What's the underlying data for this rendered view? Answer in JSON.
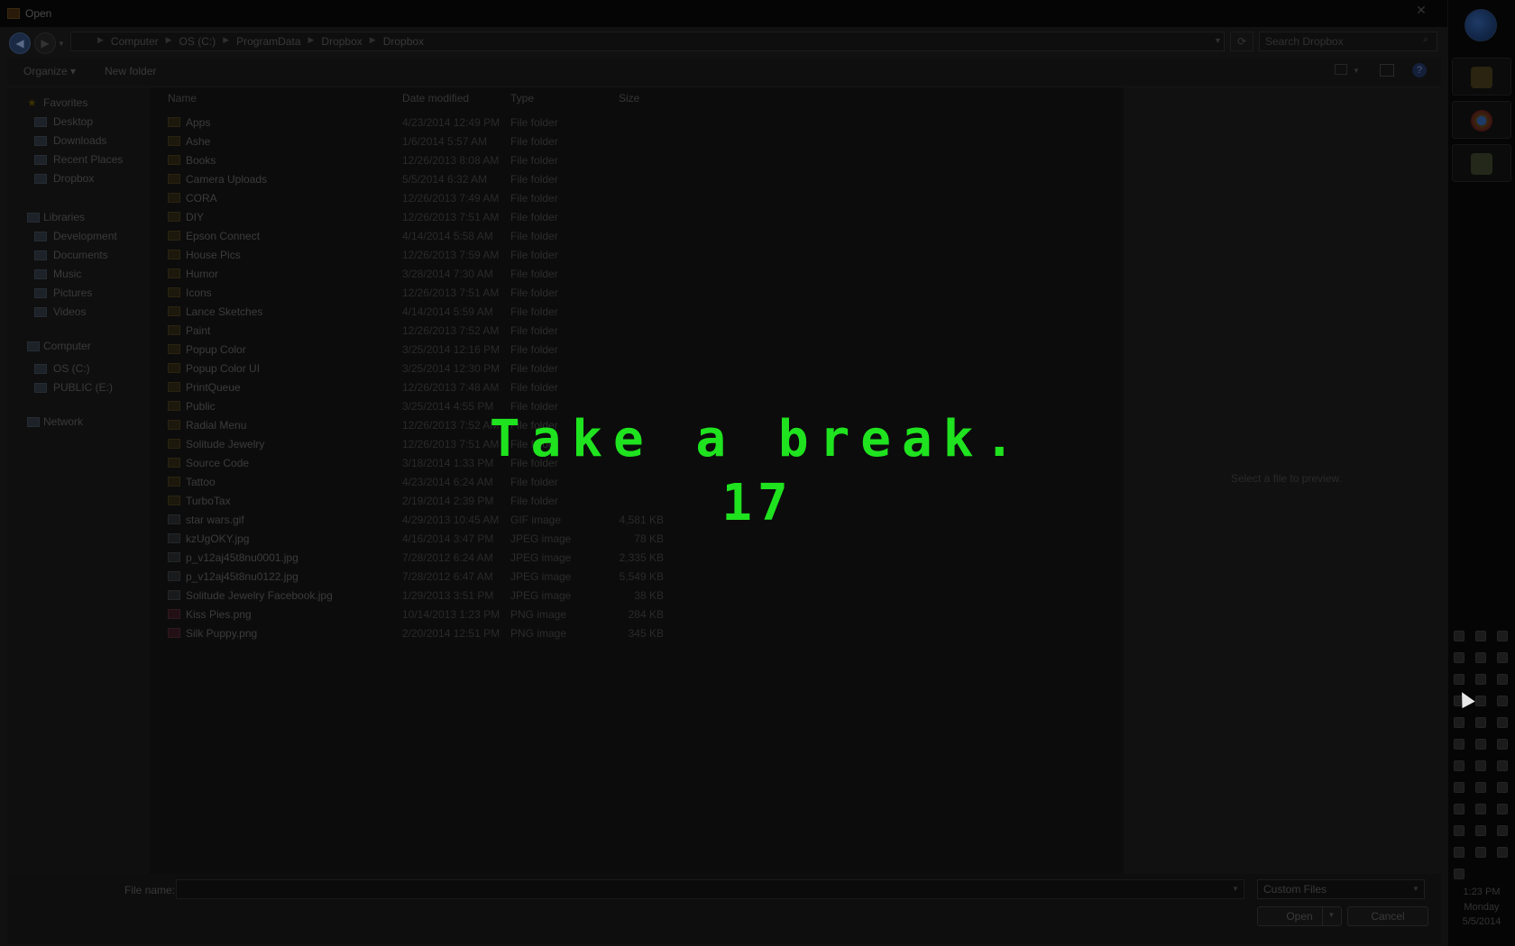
{
  "window": {
    "title": "Open"
  },
  "address": {
    "crumbs": [
      "Computer",
      "OS (C:)",
      "ProgramData",
      "Dropbox",
      "Dropbox"
    ],
    "search_placeholder": "Search Dropbox"
  },
  "toolbar": {
    "organize": "Organize ▾",
    "new_folder": "New folder"
  },
  "nav": {
    "favorites": "Favorites",
    "favorite_items": [
      "Desktop",
      "Downloads",
      "Recent Places",
      "Dropbox"
    ],
    "libraries": "Libraries",
    "library_items": [
      "Development",
      "Documents",
      "Music",
      "Pictures",
      "Videos"
    ],
    "computer": "Computer",
    "computer_items": [
      "OS (C:)",
      "PUBLIC (E:)"
    ],
    "network": "Network"
  },
  "columns": {
    "name": "Name",
    "date": "Date modified",
    "type": "Type",
    "size": "Size"
  },
  "files": [
    {
      "name": "Apps",
      "date": "4/23/2014 12:49 PM",
      "type": "File folder",
      "size": "",
      "kind": "folder"
    },
    {
      "name": "Ashe",
      "date": "1/6/2014 5:57 AM",
      "type": "File folder",
      "size": "",
      "kind": "folder"
    },
    {
      "name": "Books",
      "date": "12/26/2013 8:08 AM",
      "type": "File folder",
      "size": "",
      "kind": "folder"
    },
    {
      "name": "Camera Uploads",
      "date": "5/5/2014 6:32 AM",
      "type": "File folder",
      "size": "",
      "kind": "folder"
    },
    {
      "name": "CORA",
      "date": "12/26/2013 7:49 AM",
      "type": "File folder",
      "size": "",
      "kind": "folder"
    },
    {
      "name": "DIY",
      "date": "12/26/2013 7:51 AM",
      "type": "File folder",
      "size": "",
      "kind": "folder"
    },
    {
      "name": "Epson Connect",
      "date": "4/14/2014 5:58 AM",
      "type": "File folder",
      "size": "",
      "kind": "folder"
    },
    {
      "name": "House Pics",
      "date": "12/26/2013 7:59 AM",
      "type": "File folder",
      "size": "",
      "kind": "folder"
    },
    {
      "name": "Humor",
      "date": "3/28/2014 7:30 AM",
      "type": "File folder",
      "size": "",
      "kind": "folder"
    },
    {
      "name": "Icons",
      "date": "12/26/2013 7:51 AM",
      "type": "File folder",
      "size": "",
      "kind": "folder"
    },
    {
      "name": "Lance Sketches",
      "date": "4/14/2014 5:59 AM",
      "type": "File folder",
      "size": "",
      "kind": "folder"
    },
    {
      "name": "Paint",
      "date": "12/26/2013 7:52 AM",
      "type": "File folder",
      "size": "",
      "kind": "folder"
    },
    {
      "name": "Popup Color",
      "date": "3/25/2014 12:16 PM",
      "type": "File folder",
      "size": "",
      "kind": "folder"
    },
    {
      "name": "Popup Color UI",
      "date": "3/25/2014 12:30 PM",
      "type": "File folder",
      "size": "",
      "kind": "folder"
    },
    {
      "name": "PrintQueue",
      "date": "12/26/2013 7:48 AM",
      "type": "File folder",
      "size": "",
      "kind": "folder"
    },
    {
      "name": "Public",
      "date": "3/25/2014 4:55 PM",
      "type": "File folder",
      "size": "",
      "kind": "folder"
    },
    {
      "name": "Radial Menu",
      "date": "12/26/2013 7:52 AM",
      "type": "File folder",
      "size": "",
      "kind": "folder"
    },
    {
      "name": "Solitude Jewelry",
      "date": "12/26/2013 7:51 AM",
      "type": "File folder",
      "size": "",
      "kind": "folder"
    },
    {
      "name": "Source Code",
      "date": "3/18/2014 1:33 PM",
      "type": "File folder",
      "size": "",
      "kind": "folder"
    },
    {
      "name": "Tattoo",
      "date": "4/23/2014 6:24 AM",
      "type": "File folder",
      "size": "",
      "kind": "folder"
    },
    {
      "name": "TurboTax",
      "date": "2/19/2014 2:39 PM",
      "type": "File folder",
      "size": "",
      "kind": "folder"
    },
    {
      "name": "star wars.gif",
      "date": "4/29/2013 10:45 AM",
      "type": "GIF image",
      "size": "4,581 KB",
      "kind": "img"
    },
    {
      "name": "kzUgOKY.jpg",
      "date": "4/16/2014 3:47 PM",
      "type": "JPEG image",
      "size": "78 KB",
      "kind": "img"
    },
    {
      "name": "p_v12aj45t8nu0001.jpg",
      "date": "7/28/2012 6:24 AM",
      "type": "JPEG image",
      "size": "2,335 KB",
      "kind": "img"
    },
    {
      "name": "p_v12aj45t8nu0122.jpg",
      "date": "7/28/2012 6:47 AM",
      "type": "JPEG image",
      "size": "5,549 KB",
      "kind": "img"
    },
    {
      "name": "Solitude Jewelry Facebook.jpg",
      "date": "1/29/2013 3:51 PM",
      "type": "JPEG image",
      "size": "38 KB",
      "kind": "img"
    },
    {
      "name": "Kiss Pies.png",
      "date": "10/14/2013 1:23 PM",
      "type": "PNG image",
      "size": "284 KB",
      "kind": "png"
    },
    {
      "name": "Silk Puppy.png",
      "date": "2/20/2014 12:51 PM",
      "type": "PNG image",
      "size": "345 KB",
      "kind": "png"
    }
  ],
  "preview": {
    "empty_text": "Select a file to preview."
  },
  "footer": {
    "file_name_label": "File name:",
    "file_name_value": "",
    "filter": "Custom Files",
    "open": "Open",
    "cancel": "Cancel"
  },
  "overlay": {
    "message": "Take a break.",
    "countdown": "17",
    "color": "#1fe31f"
  },
  "taskbar": {
    "clock_time": "1:23 PM",
    "clock_day": "Monday",
    "clock_date": "5/5/2014",
    "pinned": [
      "tools-icon",
      "chrome-icon",
      "notepad-icon"
    ]
  }
}
